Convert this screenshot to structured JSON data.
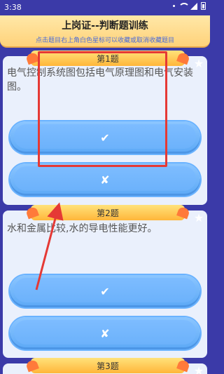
{
  "status": {
    "time": "3:38"
  },
  "header": {
    "title": "上岗证--判断题训练",
    "subtitle": "点击题目右上角白色星标可以收藏或取消收藏题目"
  },
  "questions": [
    {
      "label": "第1题",
      "text": "电气控制系统图包括电气原理图和电气安装图。",
      "true_label": "✔",
      "false_label": "✘"
    },
    {
      "label": "第2题",
      "text": "水和金属比较,水的导电性能更好。",
      "true_label": "✔",
      "false_label": "✘"
    },
    {
      "label": "第3题"
    }
  ],
  "icons": {
    "favorite": "star-icon"
  },
  "colors": {
    "accent": "#5ba8f6",
    "header": "#ffd27a",
    "background": "#3b3aa8",
    "annotation": "#e53935"
  }
}
